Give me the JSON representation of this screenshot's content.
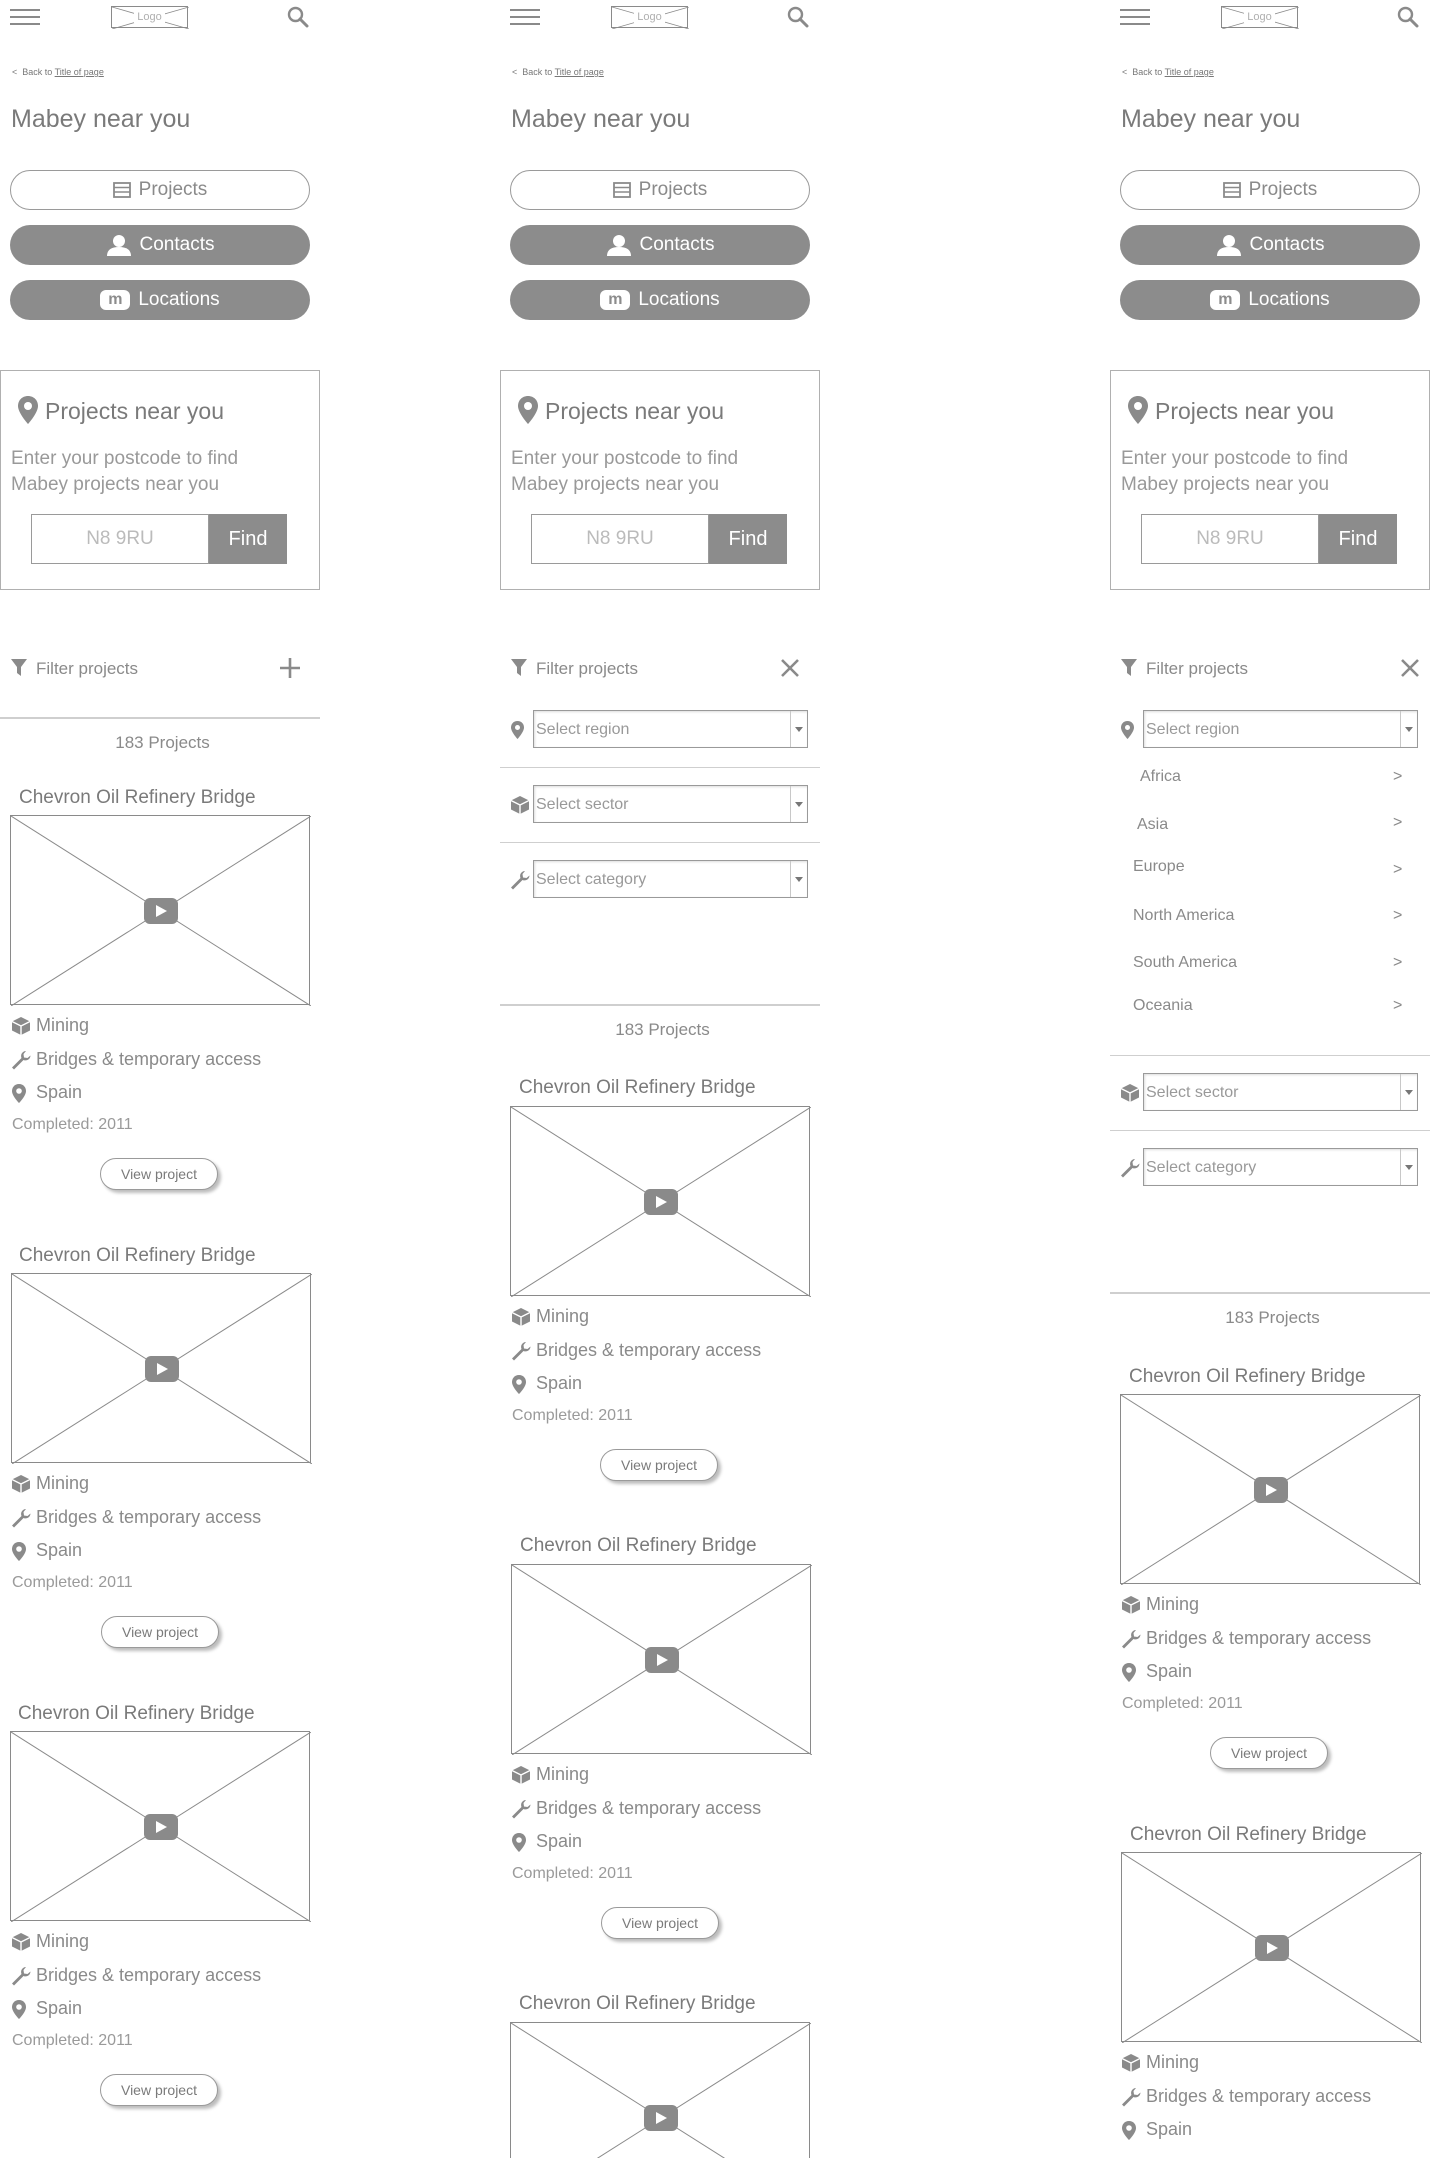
{
  "header": {
    "logo_label": "Logo"
  },
  "back_link": {
    "prefix": "Back to",
    "link": "Title of page"
  },
  "page_title": "Mabey near you",
  "nav": {
    "projects": "Projects",
    "contacts": "Contacts",
    "locations": "Locations",
    "locations_badge": "m"
  },
  "near_you": {
    "title": "Projects near you",
    "text_line1": "Enter your postcode to find",
    "text_line2": "Mabey projects near you",
    "postcode_value": "N8 9RU",
    "find_label": "Find"
  },
  "filter": {
    "label": "Filter projects",
    "open_icon": "plus-icon",
    "close_icon": "close-icon",
    "region_placeholder": "Select region",
    "sector_placeholder": "Select sector",
    "category_placeholder": "Select category",
    "regions": [
      "Africa",
      "Asia",
      "Europe",
      "North America",
      "South America",
      "Oceania"
    ],
    "chevron": ">"
  },
  "results_count": "183 Projects",
  "project": {
    "title": "Chevron Oil Refinery Bridge",
    "sector": "Mining",
    "category": "Bridges & temporary access",
    "location": "Spain",
    "completed": "Completed: 2011",
    "view_label": "View project"
  }
}
